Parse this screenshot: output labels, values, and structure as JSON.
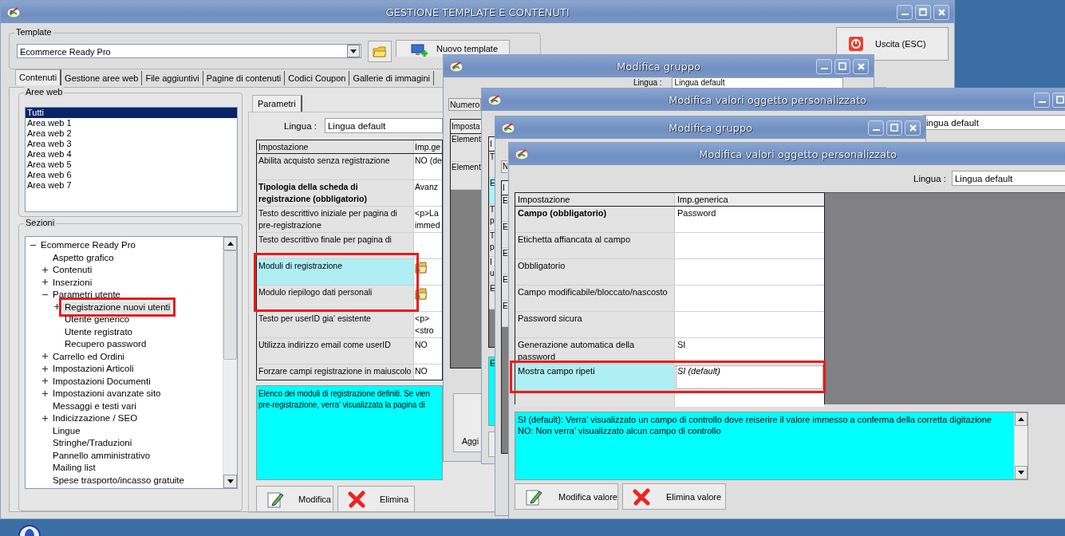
{
  "main_window": {
    "title": "GESTIONE TEMPLATE E CONTENUTI",
    "template": {
      "label": "Template",
      "value": "Ecommerce Ready Pro"
    },
    "new_template_button": "Nuovo template",
    "exit_button": "Uscita (ESC)",
    "tabs": [
      {
        "label": "Contenuti",
        "selected": true
      },
      {
        "label": "Gestione aree web",
        "selected": false
      },
      {
        "label": "File aggiuntivi",
        "selected": false
      },
      {
        "label": "Pagine di contenuti",
        "selected": false
      },
      {
        "label": "Codici Coupon",
        "selected": false
      },
      {
        "label": "Gallerie di immagini",
        "selected": false
      }
    ],
    "web_areas": {
      "label": "Aree web",
      "items": [
        {
          "label": "Tutti",
          "selected": true
        },
        {
          "label": "Area web 1",
          "selected": false
        },
        {
          "label": "Area web 2",
          "selected": false
        },
        {
          "label": "Area web 3",
          "selected": false
        },
        {
          "label": "Area web 4",
          "selected": false
        },
        {
          "label": "Area web 5",
          "selected": false
        },
        {
          "label": "Area web 6",
          "selected": false
        },
        {
          "label": "Area web 7",
          "selected": false
        }
      ]
    },
    "sections": {
      "label": "Sezioni",
      "tree": [
        {
          "label": "Ecommerce Ready Pro",
          "expanded": true,
          "selected": false,
          "highlighted": false,
          "children": [
            {
              "label": "Aspetto grafico",
              "selected": false,
              "highlighted": false
            },
            {
              "label": "Contenuti",
              "expanded": false,
              "selected": false,
              "highlighted": false
            },
            {
              "label": "Inserzioni",
              "expanded": false,
              "selected": false,
              "highlighted": false
            },
            {
              "label": "Parametri utente",
              "expanded": true,
              "selected": false,
              "highlighted": false,
              "children": [
                {
                  "label": "Registrazione nuovi utenti",
                  "expanded": false,
                  "selected": true,
                  "highlighted": true
                },
                {
                  "label": "Utente generico",
                  "selected": false,
                  "highlighted": false
                },
                {
                  "label": "Utente registrato",
                  "selected": false,
                  "highlighted": false
                },
                {
                  "label": "Recupero password",
                  "selected": false,
                  "highlighted": false
                }
              ]
            },
            {
              "label": "Carrello ed Ordini",
              "expanded": false,
              "selected": false,
              "highlighted": false
            },
            {
              "label": "Impostazioni Articoli",
              "expanded": false,
              "selected": false,
              "highlighted": false
            },
            {
              "label": "Impostazioni Documenti",
              "expanded": false,
              "selected": false,
              "highlighted": false
            },
            {
              "label": "Impostazioni avanzate sito",
              "expanded": false,
              "selected": false,
              "highlighted": false
            },
            {
              "label": "Messaggi e testi vari",
              "selected": false,
              "highlighted": false
            },
            {
              "label": "Indicizzazione / SEO",
              "expanded": false,
              "selected": false,
              "highlighted": false
            },
            {
              "label": "Lingue",
              "selected": false,
              "highlighted": false
            },
            {
              "label": "Stringhe/Traduzioni",
              "selected": false,
              "highlighted": false
            },
            {
              "label": "Pannello amministrativo",
              "selected": false,
              "highlighted": false
            },
            {
              "label": "Mailing list",
              "selected": false,
              "highlighted": false
            },
            {
              "label": "Spese trasporto/incasso gratuite",
              "selected": false,
              "highlighted": false
            }
          ]
        }
      ]
    },
    "parameters": {
      "tab": {
        "label": "Parametri",
        "selected": true
      },
      "language": {
        "label": "Lingua :",
        "value": "Lingua default"
      },
      "grid": {
        "columns": [
          "Impostazione",
          "Imp.ge"
        ],
        "rows": [
          {
            "setting": "Abilita acquisto senza registrazione",
            "required": false,
            "selected": false,
            "highlighted": false,
            "kind": "text",
            "value_lines": [
              "NO (de"
            ]
          },
          {
            "setting": "Tipologia della scheda di registrazione (obbligatorio)",
            "required": true,
            "selected": false,
            "highlighted": false,
            "kind": "text",
            "value_lines": [
              "Avanz"
            ]
          },
          {
            "setting": "Testo descrittivo iniziale per pagina di pre-registrazione",
            "required": false,
            "selected": false,
            "highlighted": false,
            "kind": "text",
            "value_lines": [
              "<p>La",
              "immed"
            ]
          },
          {
            "setting": "Testo descrittivo finale per pagina di",
            "required": false,
            "selected": false,
            "highlighted": false,
            "kind": "text"
          },
          {
            "setting": "Moduli di registrazione",
            "required": false,
            "selected": true,
            "highlighted": true,
            "kind": "folder"
          },
          {
            "setting": "Modulo riepilogo dati personali",
            "required": false,
            "selected": false,
            "highlighted": true,
            "kind": "folder"
          },
          {
            "setting": "Testo per userID gia' esistente",
            "required": false,
            "selected": false,
            "highlighted": false,
            "kind": "text",
            "value_lines": [
              "<p>",
              "<stro"
            ]
          },
          {
            "setting": "Utilizza indirizzo email come userID",
            "required": false,
            "selected": false,
            "highlighted": false,
            "kind": "text",
            "value_lines": [
              "NO"
            ]
          },
          {
            "setting": "Forzare campi registrazione in maiuscolo",
            "required": false,
            "selected": false,
            "highlighted": false,
            "kind": "text",
            "value_lines": [
              "NO"
            ]
          }
        ]
      },
      "description": [
        "Elenco dei moduli di registrazione definiti. Se vien",
        "pre-registrazione, verra' visualizzata la pagina di"
      ],
      "buttons": [
        {
          "label": "Modifica",
          "kind": "edit"
        },
        {
          "label": "Elimina",
          "kind": "delete"
        }
      ]
    }
  },
  "group_window_back": {
    "title": "Modifica gruppo",
    "language": {
      "label": "Lingua :",
      "value": "Lingua default"
    },
    "number_label": "Numero",
    "grid": {
      "header": "Imposta",
      "rows": [
        "Element",
        "Element"
      ]
    },
    "button": "Aggi"
  },
  "values_window_back": {
    "title": "Modifica valori oggetto personalizzato",
    "language_value": "ingua default",
    "grid": {
      "header": "I",
      "rows": [
        {
          "lines": [
            "T"
          ],
          "selected": false
        },
        {
          "lines": [
            "E"
          ],
          "selected": true
        },
        {
          "lines": [
            "T",
            "p"
          ],
          "selected": false
        },
        {
          "lines": [
            "T",
            "p"
          ],
          "selected": false
        },
        {
          "lines": [
            "I",
            "u"
          ],
          "selected": false
        },
        {
          "lines": [
            "E"
          ],
          "selected": false
        }
      ]
    },
    "description": "E"
  },
  "group_window_front": {
    "title": "Modifica gruppo",
    "number_label": "N",
    "grid": {
      "header": "I",
      "rows": [
        "E",
        "E",
        "E",
        "E",
        "E"
      ]
    }
  },
  "values_window": {
    "title": "Modifica valori oggetto personalizzato",
    "language": {
      "label": "Lingua :",
      "value": "Lingua default"
    },
    "grid": {
      "columns": [
        "Impostazione",
        "Imp.generica"
      ],
      "rows": [
        {
          "setting": "Campo (obbligatorio)",
          "required": true,
          "selected": false,
          "highlighted": false,
          "is_default": false,
          "value": "Password"
        },
        {
          "setting": "Etichetta affiancata al campo",
          "required": false,
          "selected": false,
          "highlighted": false
        },
        {
          "setting": "Obbligatorio",
          "required": false,
          "selected": false,
          "highlighted": false
        },
        {
          "setting": "Campo modificabile/bloccato/nascosto",
          "required": false,
          "selected": false,
          "highlighted": false
        },
        {
          "setting": "Password sicura",
          "required": false,
          "selected": false,
          "highlighted": false
        },
        {
          "setting": "Generazione automatica della password",
          "required": false,
          "selected": false,
          "highlighted": false,
          "is_default": false,
          "value": "SI"
        },
        {
          "setting": "Mostra campo ripeti",
          "required": false,
          "selected": true,
          "highlighted": true,
          "is_default": true,
          "value": "SI (default)"
        }
      ]
    },
    "description": [
      "SI (default): Verra' visualizzato un campo di controllo dove reiserire il valore immesso a conferma della corretta digitazione",
      "NO: Non verra' visualizzato alcun campo di controllo"
    ],
    "buttons": [
      {
        "label": "Modifica valore",
        "kind": "edit"
      },
      {
        "label": "Elimina valore",
        "kind": "delete"
      }
    ]
  }
}
